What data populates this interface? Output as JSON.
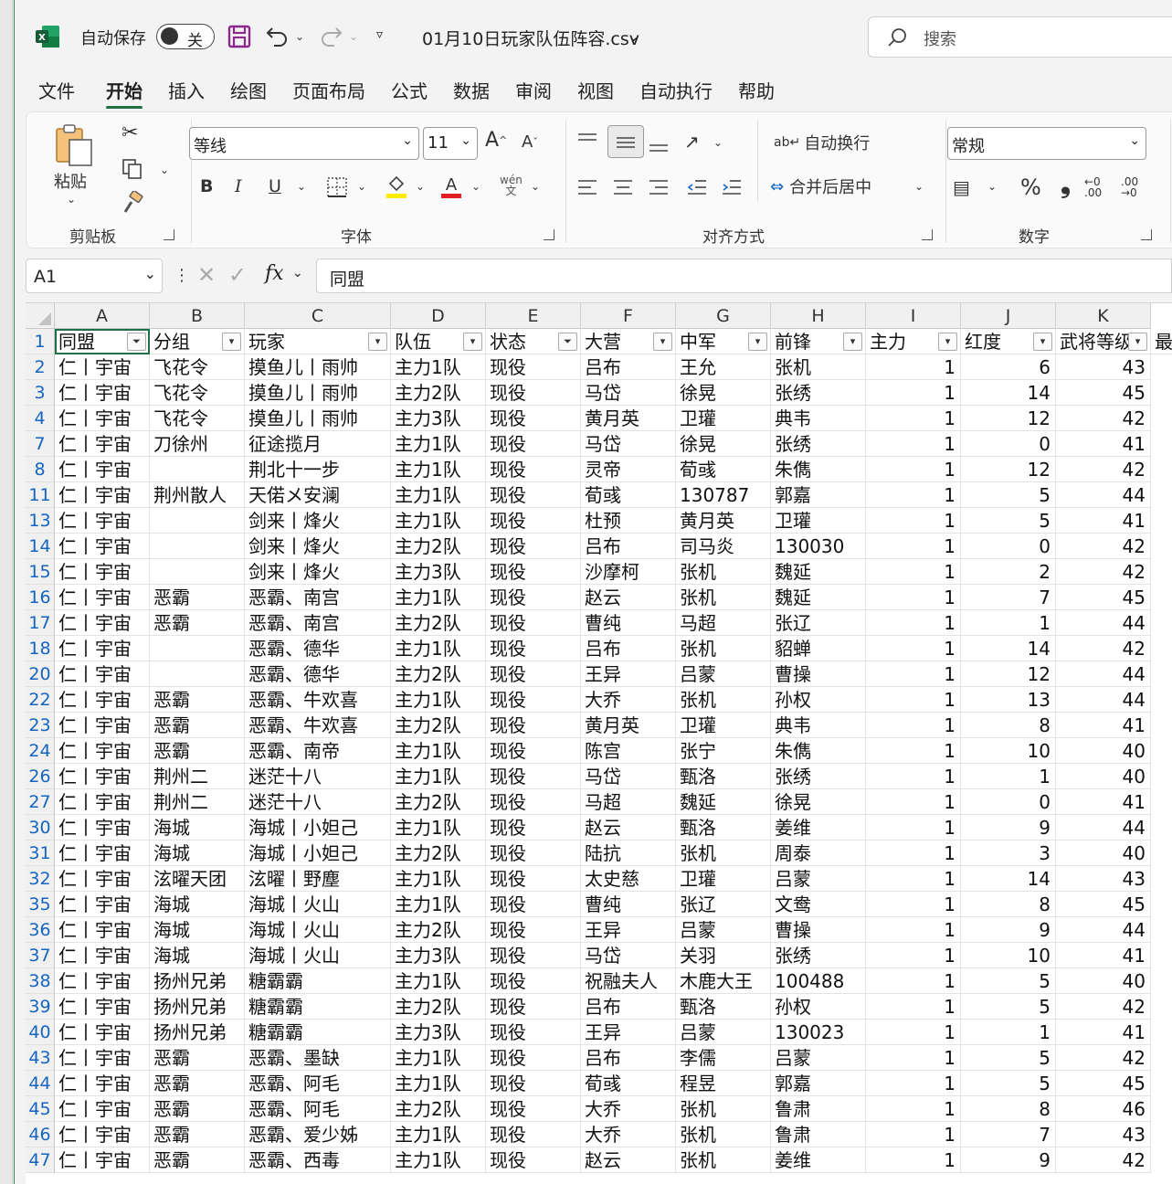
{
  "title": {
    "autosave_label": "自动保存",
    "autosave_state": "关",
    "filename": "01月10日玩家队伍阵容.csv",
    "search_placeholder": "搜索"
  },
  "menu": [
    "文件",
    "开始",
    "插入",
    "绘图",
    "页面布局",
    "公式",
    "数据",
    "审阅",
    "视图",
    "自动执行",
    "帮助"
  ],
  "menu_active": "开始",
  "ribbon": {
    "clipboard": {
      "paste_label": "粘贴",
      "group_label": "剪贴板"
    },
    "font": {
      "font_name": "等线",
      "font_size": "11",
      "group_label": "字体",
      "bold": "B",
      "italic": "I",
      "underline": "U",
      "grow": "A",
      "shrink": "A",
      "phonetic": "wén"
    },
    "alignment": {
      "wrap_label": "自动换行",
      "merge_label": "合并后居中",
      "group_label": "对齐方式"
    },
    "number": {
      "format": "常规",
      "percent": "%",
      "comma": "❟",
      "group_label": "数字"
    }
  },
  "formula_bar": {
    "name_box": "A1",
    "fx": "fx",
    "content": "同盟"
  },
  "columns": [
    "A",
    "B",
    "C",
    "D",
    "E",
    "F",
    "G",
    "H",
    "I",
    "J",
    "K"
  ],
  "header_row": {
    "row": "1",
    "cells": [
      "同盟",
      "分组",
      "玩家",
      "队伍",
      "状态",
      "大营",
      "中军",
      "前锋",
      "主力",
      "红度",
      "武将等级"
    ],
    "filtered": [
      true,
      false,
      false,
      false,
      true,
      false,
      false,
      false,
      false,
      false,
      false
    ],
    "overflow": "最"
  },
  "rows": [
    {
      "row": "2",
      "cells": [
        "仁丨宇宙",
        "飞花令",
        "摸鱼儿丨雨帅",
        "主力1队",
        "现役",
        "吕布",
        "王允",
        "张机",
        "1",
        "6",
        "43"
      ]
    },
    {
      "row": "3",
      "cells": [
        "仁丨宇宙",
        "飞花令",
        "摸鱼儿丨雨帅",
        "主力2队",
        "现役",
        "马岱",
        "徐晃",
        "张绣",
        "1",
        "14",
        "45"
      ]
    },
    {
      "row": "4",
      "cells": [
        "仁丨宇宙",
        "飞花令",
        "摸鱼儿丨雨帅",
        "主力3队",
        "现役",
        "黄月英",
        "卫瓘",
        "典韦",
        "1",
        "12",
        "42"
      ]
    },
    {
      "row": "7",
      "cells": [
        "仁丨宇宙",
        "刀徐州",
        "征途揽月",
        "主力1队",
        "现役",
        "马岱",
        "徐晃",
        "张绣",
        "1",
        "0",
        "41"
      ]
    },
    {
      "row": "8",
      "cells": [
        "仁丨宇宙",
        "",
        "荆北十一步",
        "主力1队",
        "现役",
        "灵帝",
        "荀彧",
        "朱儁",
        "1",
        "12",
        "42"
      ]
    },
    {
      "row": "11",
      "cells": [
        "仁丨宇宙",
        "荆州散人",
        "天偌メ安澜",
        "主力1队",
        "现役",
        "荀彧",
        "130787",
        "郭嘉",
        "1",
        "5",
        "44"
      ]
    },
    {
      "row": "13",
      "cells": [
        "仁丨宇宙",
        "",
        "剑来丨烽火",
        "主力1队",
        "现役",
        "杜预",
        "黄月英",
        "卫瓘",
        "1",
        "5",
        "41"
      ]
    },
    {
      "row": "14",
      "cells": [
        "仁丨宇宙",
        "",
        "剑来丨烽火",
        "主力2队",
        "现役",
        "吕布",
        "司马炎",
        "130030",
        "1",
        "0",
        "42"
      ]
    },
    {
      "row": "15",
      "cells": [
        "仁丨宇宙",
        "",
        "剑来丨烽火",
        "主力3队",
        "现役",
        "沙摩柯",
        "张机",
        "魏延",
        "1",
        "2",
        "42"
      ]
    },
    {
      "row": "16",
      "cells": [
        "仁丨宇宙",
        "恶霸",
        "恶霸、南宫",
        "主力1队",
        "现役",
        "赵云",
        "张机",
        "魏延",
        "1",
        "7",
        "45"
      ]
    },
    {
      "row": "17",
      "cells": [
        "仁丨宇宙",
        "恶霸",
        "恶霸、南宫",
        "主力2队",
        "现役",
        "曹纯",
        "马超",
        "张辽",
        "1",
        "1",
        "44"
      ]
    },
    {
      "row": "18",
      "cells": [
        "仁丨宇宙",
        "",
        "恶霸、德华",
        "主力1队",
        "现役",
        "吕布",
        "张机",
        "貂蝉",
        "1",
        "14",
        "42"
      ]
    },
    {
      "row": "20",
      "cells": [
        "仁丨宇宙",
        "",
        "恶霸、德华",
        "主力2队",
        "现役",
        "王异",
        "吕蒙",
        "曹操",
        "1",
        "12",
        "44"
      ]
    },
    {
      "row": "22",
      "cells": [
        "仁丨宇宙",
        "恶霸",
        "恶霸、牛欢喜",
        "主力1队",
        "现役",
        "大乔",
        "张机",
        "孙权",
        "1",
        "13",
        "44"
      ]
    },
    {
      "row": "23",
      "cells": [
        "仁丨宇宙",
        "恶霸",
        "恶霸、牛欢喜",
        "主力2队",
        "现役",
        "黄月英",
        "卫瓘",
        "典韦",
        "1",
        "8",
        "41"
      ]
    },
    {
      "row": "24",
      "cells": [
        "仁丨宇宙",
        "恶霸",
        "恶霸、南帝",
        "主力1队",
        "现役",
        "陈宫",
        "张宁",
        "朱儁",
        "1",
        "10",
        "40"
      ]
    },
    {
      "row": "26",
      "cells": [
        "仁丨宇宙",
        "荆州二",
        "迷茫十八",
        "主力1队",
        "现役",
        "马岱",
        "甄洛",
        "张绣",
        "1",
        "1",
        "40"
      ]
    },
    {
      "row": "27",
      "cells": [
        "仁丨宇宙",
        "荆州二",
        "迷茫十八",
        "主力2队",
        "现役",
        "马超",
        "魏延",
        "徐晃",
        "1",
        "0",
        "41"
      ]
    },
    {
      "row": "30",
      "cells": [
        "仁丨宇宙",
        "海城",
        "海城丨小妲己",
        "主力1队",
        "现役",
        "赵云",
        "甄洛",
        "姜维",
        "1",
        "9",
        "44"
      ]
    },
    {
      "row": "31",
      "cells": [
        "仁丨宇宙",
        "海城",
        "海城丨小妲己",
        "主力2队",
        "现役",
        "陆抗",
        "张机",
        "周泰",
        "1",
        "3",
        "40"
      ]
    },
    {
      "row": "32",
      "cells": [
        "仁丨宇宙",
        "泫曜天团",
        "泫曜丨野塵",
        "主力1队",
        "现役",
        "太史慈",
        "卫瓘",
        "吕蒙",
        "1",
        "14",
        "43"
      ]
    },
    {
      "row": "35",
      "cells": [
        "仁丨宇宙",
        "海城",
        "海城丨火山",
        "主力1队",
        "现役",
        "曹纯",
        "张辽",
        "文鸯",
        "1",
        "8",
        "45"
      ]
    },
    {
      "row": "36",
      "cells": [
        "仁丨宇宙",
        "海城",
        "海城丨火山",
        "主力2队",
        "现役",
        "王异",
        "吕蒙",
        "曹操",
        "1",
        "9",
        "44"
      ]
    },
    {
      "row": "37",
      "cells": [
        "仁丨宇宙",
        "海城",
        "海城丨火山",
        "主力3队",
        "现役",
        "马岱",
        "关羽",
        "张绣",
        "1",
        "10",
        "41"
      ]
    },
    {
      "row": "38",
      "cells": [
        "仁丨宇宙",
        "扬州兄弟",
        "糖霸霸",
        "主力1队",
        "现役",
        "祝融夫人",
        "木鹿大王",
        "100488",
        "1",
        "5",
        "40"
      ]
    },
    {
      "row": "39",
      "cells": [
        "仁丨宇宙",
        "扬州兄弟",
        "糖霸霸",
        "主力2队",
        "现役",
        "吕布",
        "甄洛",
        "孙权",
        "1",
        "5",
        "42"
      ]
    },
    {
      "row": "40",
      "cells": [
        "仁丨宇宙",
        "扬州兄弟",
        "糖霸霸",
        "主力3队",
        "现役",
        "王异",
        "吕蒙",
        "130023",
        "1",
        "1",
        "41"
      ]
    },
    {
      "row": "43",
      "cells": [
        "仁丨宇宙",
        "恶霸",
        "恶霸、墨缺",
        "主力1队",
        "现役",
        "吕布",
        "李儒",
        "吕蒙",
        "1",
        "5",
        "42"
      ]
    },
    {
      "row": "44",
      "cells": [
        "仁丨宇宙",
        "恶霸",
        "恶霸、阿毛",
        "主力1队",
        "现役",
        "荀彧",
        "程昱",
        "郭嘉",
        "1",
        "5",
        "45"
      ]
    },
    {
      "row": "45",
      "cells": [
        "仁丨宇宙",
        "恶霸",
        "恶霸、阿毛",
        "主力2队",
        "现役",
        "大乔",
        "张机",
        "鲁肃",
        "1",
        "8",
        "46"
      ]
    },
    {
      "row": "46",
      "cells": [
        "仁丨宇宙",
        "恶霸",
        "恶霸、爱少姊",
        "主力1队",
        "现役",
        "大乔",
        "张机",
        "鲁肃",
        "1",
        "7",
        "43"
      ]
    },
    {
      "row": "47",
      "cells": [
        "仁丨宇宙",
        "恶霸",
        "恶霸、西毒",
        "主力1队",
        "现役",
        "赵云",
        "张机",
        "姜维",
        "1",
        "9",
        "42"
      ]
    }
  ]
}
